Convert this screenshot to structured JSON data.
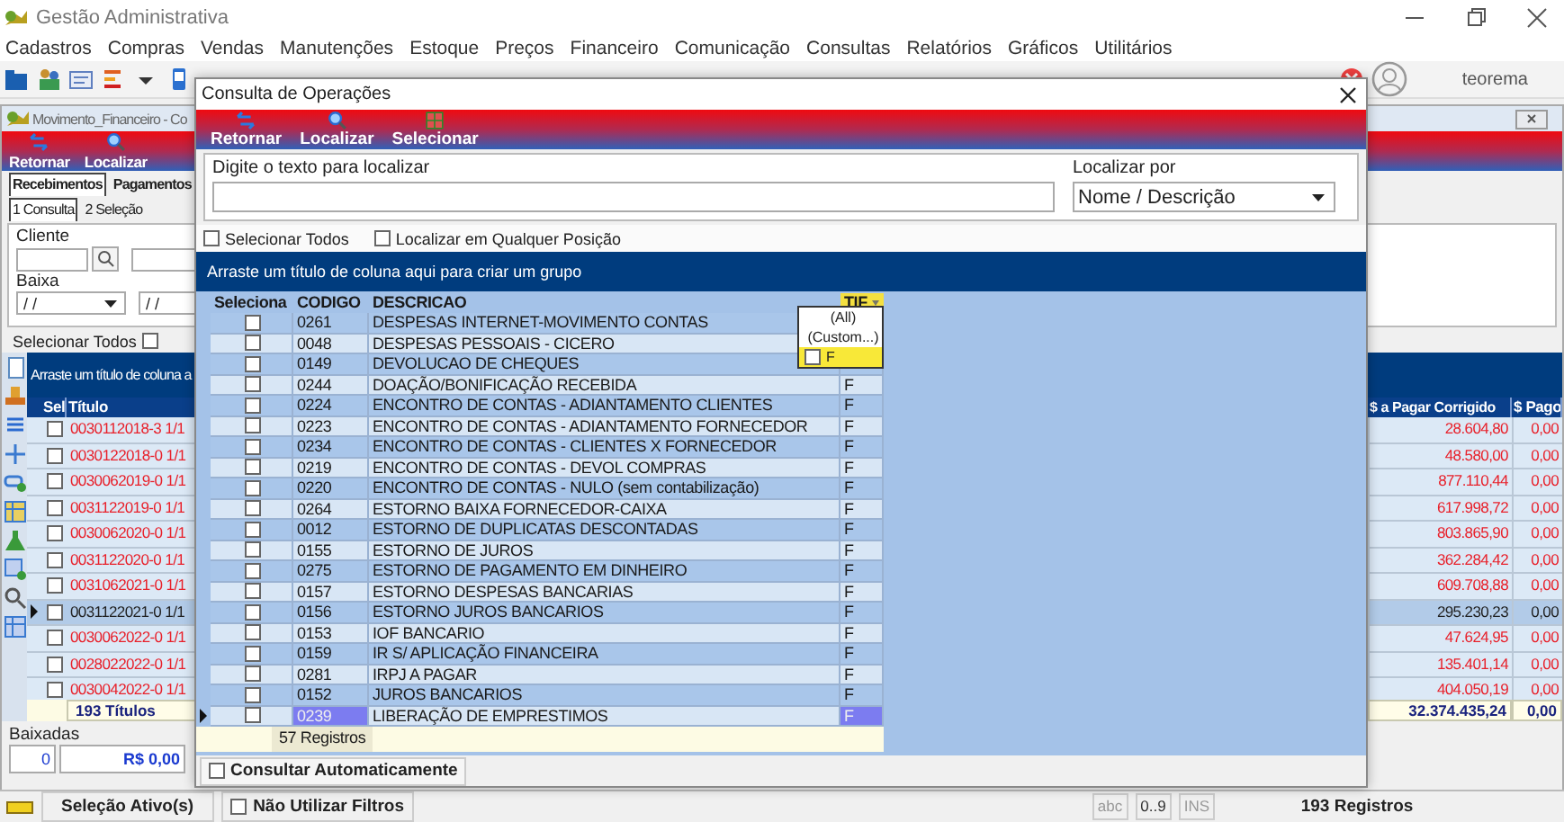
{
  "app": {
    "title": "Gestão Administrativa",
    "menu": [
      "Cadastros",
      "Compras",
      "Vendas",
      "Manutenções",
      "Estoque",
      "Preços",
      "Financeiro",
      "Comunicação",
      "Consultas",
      "Relatórios",
      "Gráficos",
      "Utilitários"
    ],
    "user": "teorema"
  },
  "child_window": {
    "title": "Movimento_Financeiro - Co",
    "toolbar": [
      "Retornar",
      "Localizar"
    ],
    "tabs": [
      {
        "label": "Recebimentos",
        "selected": true
      },
      {
        "label": "Pagamentos",
        "selected": false
      }
    ],
    "subtabs": [
      {
        "label": "1 Consulta",
        "selected": true
      },
      {
        "label": "2 Seleção",
        "selected": false
      }
    ],
    "filters": {
      "cliente_label": "Cliente",
      "baixa_label": "Baixa",
      "date_from": "/ /",
      "date_to": "/ /"
    },
    "select_all": {
      "label": "Selecionar Todos",
      "checked": false
    },
    "grid": {
      "group_hint": "Arraste um título de coluna a",
      "columns": [
        "Sel",
        "Título",
        "$ a Pagar Corrigido",
        "$ Pago"
      ],
      "rows": [
        {
          "title": "0030112018-3 1/1",
          "corrected": "28.604,80",
          "paid": "0,00",
          "checked": false,
          "selected": false
        },
        {
          "title": "0030122018-0 1/1",
          "corrected": "48.580,00",
          "paid": "0,00",
          "checked": false,
          "selected": false
        },
        {
          "title": "0030062019-0 1/1",
          "corrected": "877.110,44",
          "paid": "0,00",
          "checked": false,
          "selected": false
        },
        {
          "title": "0031122019-0 1/1",
          "corrected": "617.998,72",
          "paid": "0,00",
          "checked": false,
          "selected": false
        },
        {
          "title": "0030062020-0 1/1",
          "corrected": "803.865,90",
          "paid": "0,00",
          "checked": false,
          "selected": false
        },
        {
          "title": "0031122020-0 1/1",
          "corrected": "362.284,42",
          "paid": "0,00",
          "checked": false,
          "selected": false
        },
        {
          "title": "0031062021-0 1/1",
          "corrected": "609.708,88",
          "paid": "0,00",
          "checked": false,
          "selected": false
        },
        {
          "title": "0031122021-0 1/1",
          "corrected": "295.230,23",
          "paid": "0,00",
          "checked": false,
          "selected": true
        },
        {
          "title": "0030062022-0 1/1",
          "corrected": "47.624,95",
          "paid": "0,00",
          "checked": false,
          "selected": false
        },
        {
          "title": "0028022022-0 1/1",
          "corrected": "135.401,14",
          "paid": "0,00",
          "checked": false,
          "selected": false
        },
        {
          "title": "0030042022-0 1/1",
          "corrected": "404.050,19",
          "paid": "0,00",
          "checked": false,
          "selected": false
        }
      ],
      "footer": {
        "count": "193 Títulos",
        "total": "32.374.435,24",
        "paid": "0,00"
      }
    },
    "baixadas": {
      "label": "Baixadas",
      "count": "0",
      "amount": "R$ 0,00"
    }
  },
  "status_bar": {
    "selection": "Seleção Ativo(s)",
    "no_filters": {
      "label": "Não Utilizar Filtros",
      "checked": false
    },
    "indicators": [
      "abc",
      "0..9",
      "INS"
    ],
    "records": "193 Registros"
  },
  "dialog": {
    "title": "Consulta de Operações",
    "toolbar": [
      "Retornar",
      "Localizar",
      "Selecionar"
    ],
    "search_label": "Digite o texto para localizar",
    "locate_by": {
      "label": "Localizar por",
      "value": "Nome / Descrição"
    },
    "options": [
      {
        "label": "Selecionar Todos",
        "checked": false
      },
      {
        "label": "Localizar em Qualquer Posição",
        "checked": false
      }
    ],
    "group_hint": "Arraste um título de coluna aqui para criar um grupo",
    "columns": [
      "Seleciona",
      "CODIGO",
      "DESCRICAO",
      "TIF"
    ],
    "rows": [
      {
        "code": "0261",
        "description": "DESPESAS INTERNET-MOVIMENTO CONTAS",
        "checked": false,
        "selected": false
      },
      {
        "code": "0048",
        "description": "DESPESAS PESSOAIS - CICERO",
        "checked": false,
        "selected": false
      },
      {
        "code": "0149",
        "description": "DEVOLUCAO DE CHEQUES",
        "checked": false,
        "selected": false
      },
      {
        "code": "0244",
        "description": "DOAÇÃO/BONIFICAÇÃO RECEBIDA",
        "type": "F",
        "checked": false,
        "selected": false
      },
      {
        "code": "0224",
        "description": "ENCONTRO DE CONTAS - ADIANTAMENTO CLIENTES",
        "type": "F",
        "checked": false,
        "selected": false
      },
      {
        "code": "0223",
        "description": "ENCONTRO DE CONTAS - ADIANTAMENTO FORNECEDOR",
        "type": "F",
        "checked": false,
        "selected": false
      },
      {
        "code": "0234",
        "description": "ENCONTRO DE CONTAS - CLIENTES X FORNECEDOR",
        "type": "F",
        "checked": false,
        "selected": false
      },
      {
        "code": "0219",
        "description": "ENCONTRO DE CONTAS - DEVOL COMPRAS",
        "type": "F",
        "checked": false,
        "selected": false
      },
      {
        "code": "0220",
        "description": "ENCONTRO DE CONTAS - NULO (sem contabilização)",
        "type": "F",
        "checked": false,
        "selected": false
      },
      {
        "code": "0264",
        "description": "ESTORNO BAIXA FORNECEDOR-CAIXA",
        "type": "F",
        "checked": false,
        "selected": false
      },
      {
        "code": "0012",
        "description": "ESTORNO DE DUPLICATAS DESCONTADAS",
        "type": "F",
        "checked": false,
        "selected": false
      },
      {
        "code": "0155",
        "description": "ESTORNO DE JUROS",
        "type": "F",
        "checked": false,
        "selected": false
      },
      {
        "code": "0275",
        "description": "ESTORNO DE PAGAMENTO EM DINHEIRO",
        "type": "F",
        "checked": false,
        "selected": false
      },
      {
        "code": "0157",
        "description": "ESTORNO DESPESAS BANCARIAS",
        "type": "F",
        "checked": false,
        "selected": false
      },
      {
        "code": "0156",
        "description": "ESTORNO JUROS BANCARIOS",
        "type": "F",
        "checked": false,
        "selected": false
      },
      {
        "code": "0153",
        "description": "IOF BANCARIO",
        "type": "F",
        "checked": false,
        "selected": false
      },
      {
        "code": "0159",
        "description": "IR S/ APLICAÇÃO FINANCEIRA",
        "type": "F",
        "checked": false,
        "selected": false
      },
      {
        "code": "0281",
        "description": "IRPJ A PAGAR",
        "type": "F",
        "checked": false,
        "selected": false
      },
      {
        "code": "0152",
        "description": "JUROS BANCARIOS",
        "type": "F",
        "checked": false,
        "selected": false
      },
      {
        "code": "0239",
        "description": "LIBERAÇÃO DE EMPRESTIMOS",
        "type": "F",
        "checked": false,
        "selected": true
      }
    ],
    "filter_popup": [
      {
        "kind": "option",
        "label": "(All)",
        "selected": false
      },
      {
        "kind": "option",
        "label": "(Custom...)",
        "selected": false
      },
      {
        "kind": "checkbox",
        "label": "F",
        "checked": false,
        "selected": true
      }
    ],
    "footer": "57 Registros",
    "auto_query": {
      "label": "Consultar Automaticamente",
      "checked": false
    }
  }
}
